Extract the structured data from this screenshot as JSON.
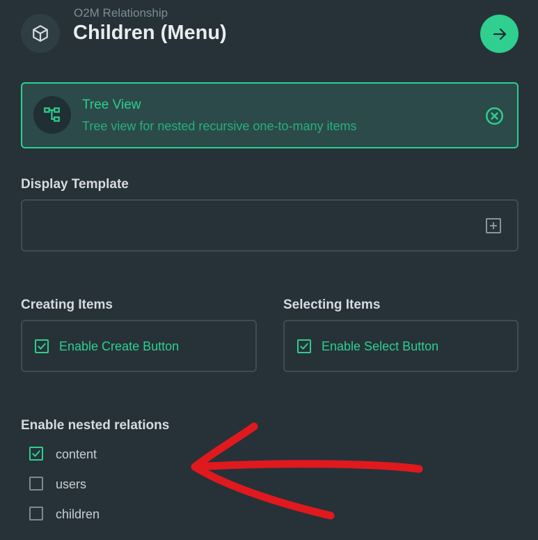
{
  "header": {
    "subtitle": "O2M Relationship",
    "title": "Children (Menu)",
    "icon": "box-icon",
    "go_icon": "arrow-right-icon",
    "accent": "#2ecf8f"
  },
  "interface": {
    "title": "Tree View",
    "description": "Tree view for nested recursive one-to-many items",
    "icon": "tree-icon",
    "close_icon": "close-circle-icon"
  },
  "display_template": {
    "label": "Display Template",
    "value": "",
    "add_icon": "plus-square-icon"
  },
  "creating": {
    "label": "Creating Items",
    "checkbox_label": "Enable Create Button",
    "checked": true
  },
  "selecting": {
    "label": "Selecting Items",
    "checkbox_label": "Enable Select Button",
    "checked": true
  },
  "nested": {
    "label": "Enable nested relations",
    "items": [
      {
        "label": "content",
        "checked": true
      },
      {
        "label": "users",
        "checked": false
      },
      {
        "label": "children",
        "checked": false
      }
    ]
  },
  "annotation": {
    "color": "#e0191e",
    "icon": "red-arrow-annotation"
  }
}
